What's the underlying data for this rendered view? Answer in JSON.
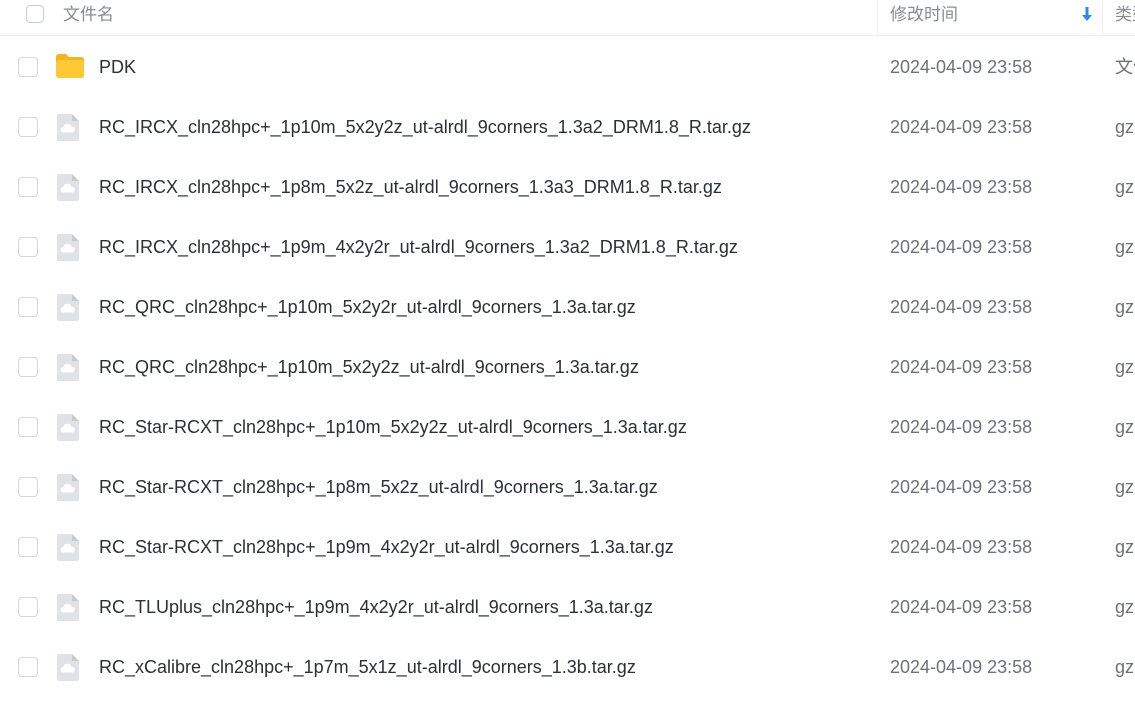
{
  "header": {
    "name_label": "文件名",
    "date_label": "修改时间",
    "type_label": "类型",
    "sort_icon": "arrow-down-icon",
    "accent_color": "#2a8cf0"
  },
  "files": [
    {
      "name": "PDK",
      "date": "2024-04-09 23:58",
      "type": "文件夹",
      "icon": "folder-icon"
    },
    {
      "name": "RC_IRCX_cln28hpc+_1p10m_5x2y2z_ut-alrdl_9corners_1.3a2_DRM1.8_R.tar.gz",
      "date": "2024-04-09 23:58",
      "type": "gz",
      "icon": "cloud-file-icon"
    },
    {
      "name": "RC_IRCX_cln28hpc+_1p8m_5x2z_ut-alrdl_9corners_1.3a3_DRM1.8_R.tar.gz",
      "date": "2024-04-09 23:58",
      "type": "gz",
      "icon": "cloud-file-icon"
    },
    {
      "name": "RC_IRCX_cln28hpc+_1p9m_4x2y2r_ut-alrdl_9corners_1.3a2_DRM1.8_R.tar.gz",
      "date": "2024-04-09 23:58",
      "type": "gz",
      "icon": "cloud-file-icon"
    },
    {
      "name": "RC_QRC_cln28hpc+_1p10m_5x2y2r_ut-alrdl_9corners_1.3a.tar.gz",
      "date": "2024-04-09 23:58",
      "type": "gz",
      "icon": "cloud-file-icon"
    },
    {
      "name": "RC_QRC_cln28hpc+_1p10m_5x2y2z_ut-alrdl_9corners_1.3a.tar.gz",
      "date": "2024-04-09 23:58",
      "type": "gz",
      "icon": "cloud-file-icon"
    },
    {
      "name": "RC_Star-RCXT_cln28hpc+_1p10m_5x2y2z_ut-alrdl_9corners_1.3a.tar.gz",
      "date": "2024-04-09 23:58",
      "type": "gz",
      "icon": "cloud-file-icon"
    },
    {
      "name": "RC_Star-RCXT_cln28hpc+_1p8m_5x2z_ut-alrdl_9corners_1.3a.tar.gz",
      "date": "2024-04-09 23:58",
      "type": "gz",
      "icon": "cloud-file-icon"
    },
    {
      "name": "RC_Star-RCXT_cln28hpc+_1p9m_4x2y2r_ut-alrdl_9corners_1.3a.tar.gz",
      "date": "2024-04-09 23:58",
      "type": "gz",
      "icon": "cloud-file-icon"
    },
    {
      "name": "RC_TLUplus_cln28hpc+_1p9m_4x2y2r_ut-alrdl_9corners_1.3a.tar.gz",
      "date": "2024-04-09 23:58",
      "type": "gz",
      "icon": "cloud-file-icon"
    },
    {
      "name": "RC_xCalibre_cln28hpc+_1p7m_5x1z_ut-alrdl_9corners_1.3b.tar.gz",
      "date": "2024-04-09 23:58",
      "type": "gz",
      "icon": "cloud-file-icon"
    }
  ]
}
